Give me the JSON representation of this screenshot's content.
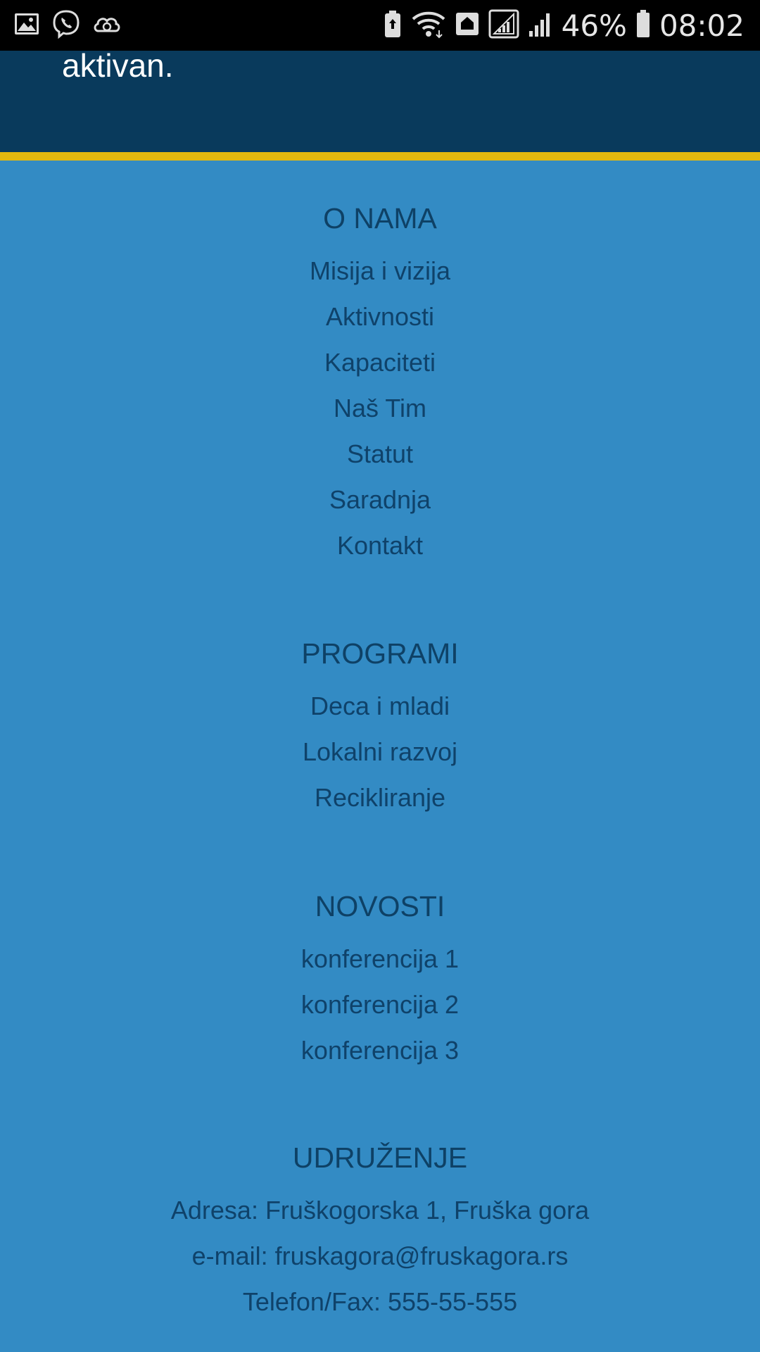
{
  "status_bar": {
    "battery_percent": "46%",
    "time": "08:02",
    "left_icons": [
      "gallery-icon",
      "viber-icon",
      "cloud-sync-icon"
    ],
    "right_icons": [
      "battery-saver-icon",
      "wifi-icon",
      "nfc-icon",
      "signal-sim1-icon",
      "signal-sim2-icon",
      "battery-icon"
    ]
  },
  "hero": {
    "text": "aktivan."
  },
  "colors": {
    "hero_bg": "#093a5c",
    "accent": "#e3b80e",
    "footer_bg": "#338bc4",
    "footer_text": "#0f426a"
  },
  "footer": {
    "about": {
      "title": "O NAMA",
      "links": [
        "Misija i vizija",
        "Aktivnosti",
        "Kapaciteti",
        "Naš Tim",
        "Statut",
        "Saradnja",
        "Kontakt"
      ]
    },
    "programs": {
      "title": "PROGRAMI",
      "links": [
        "Deca i mladi",
        "Lokalni razvoj",
        "Recikliranje"
      ]
    },
    "news": {
      "title": "NOVOSTI",
      "links": [
        "konferencija 1",
        "konferencija 2",
        "konferencija 3"
      ]
    },
    "association": {
      "title": "UDRUŽENJE",
      "address": "Adresa: Fruškogorska 1, Fruška gora",
      "email": "e-mail: fruskagora@fruskagora.rs",
      "phone": "Telefon/Fax: 555-55-555"
    }
  }
}
